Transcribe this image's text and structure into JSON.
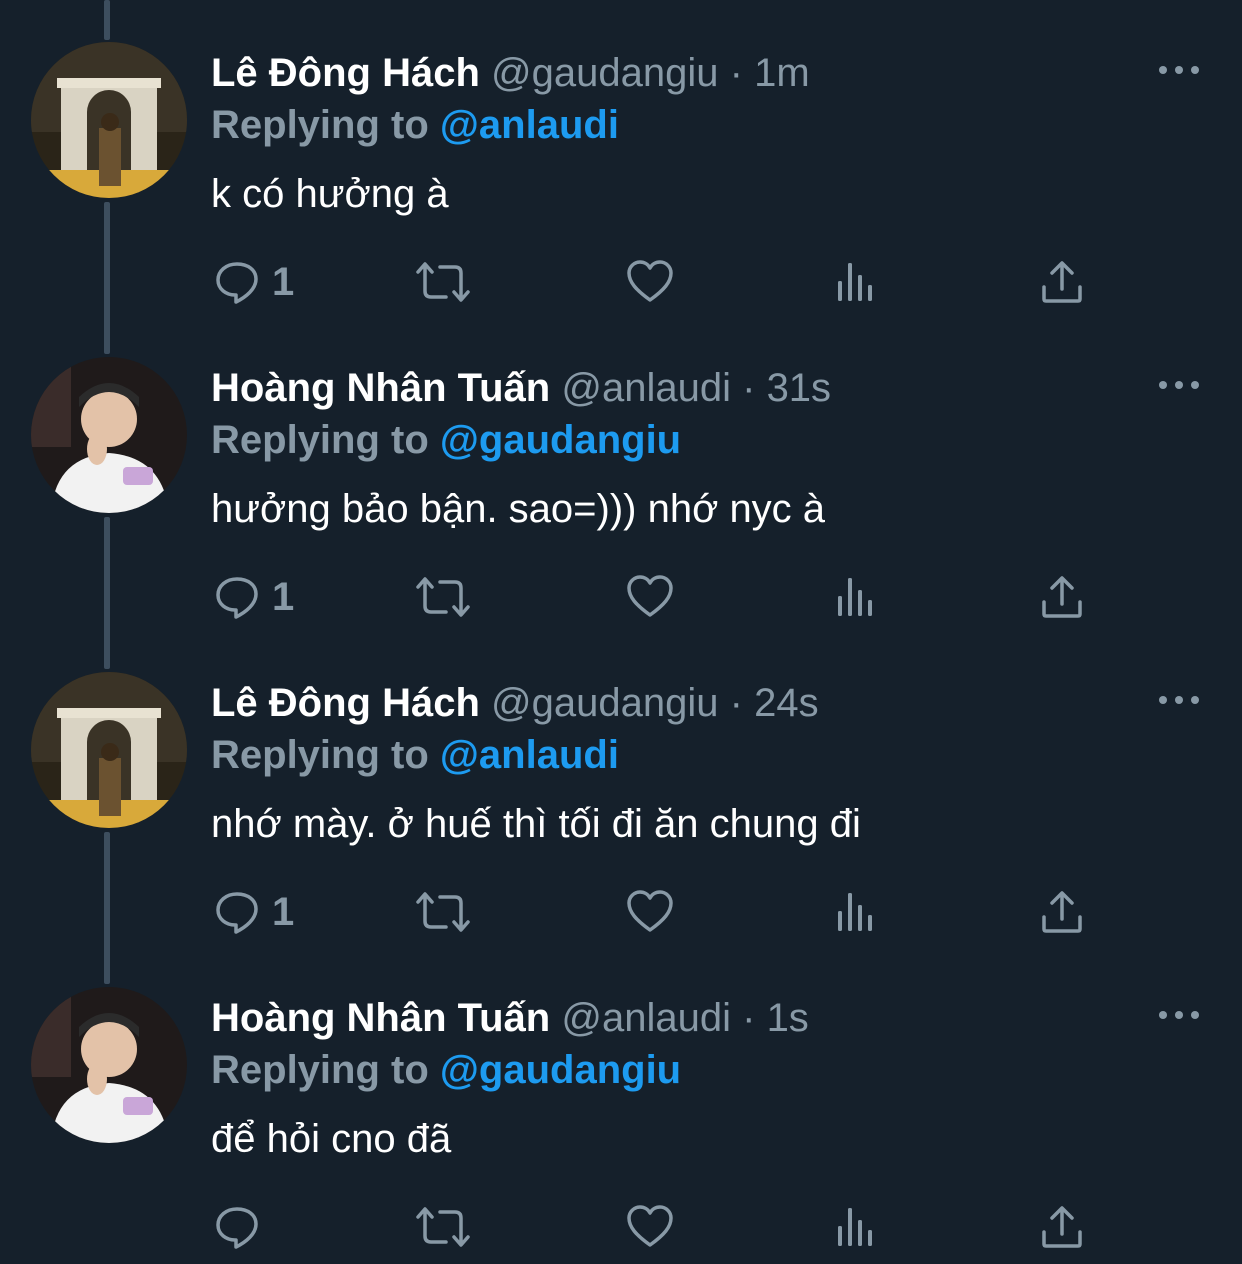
{
  "tweets": [
    {
      "display_name": "Lê Đông Hách",
      "handle": "@gaudangiu",
      "separator": "·",
      "time": "1m",
      "replying_label": "Replying to",
      "replying_handle": "@anlaudi",
      "text": "k có hưởng à",
      "reply_count": "1"
    },
    {
      "display_name": "Hoàng Nhân Tuấn",
      "handle": "@anlaudi",
      "separator": "·",
      "time": "31s",
      "replying_label": "Replying to",
      "replying_handle": "@gaudangiu",
      "text": "hưởng bảo bận. sao=))) nhớ nyc à",
      "reply_count": "1"
    },
    {
      "display_name": "Lê Đông Hách",
      "handle": "@gaudangiu",
      "separator": "·",
      "time": "24s",
      "replying_label": "Replying to",
      "replying_handle": "@anlaudi",
      "text": "nhớ mày. ở huế thì tối đi ăn chung đi",
      "reply_count": "1"
    },
    {
      "display_name": "Hoàng Nhân Tuấn",
      "handle": "@anlaudi",
      "separator": "·",
      "time": "1s",
      "replying_label": "Replying to",
      "replying_handle": "@gaudangiu",
      "text": "để hỏi cno đã",
      "reply_count": ""
    }
  ],
  "icons": {
    "reply": "reply-icon",
    "retweet": "retweet-icon",
    "like": "heart-icon",
    "views": "views-icon",
    "share": "share-icon",
    "more": "more-icon"
  },
  "colors": {
    "background": "#15202b",
    "primary_text": "#ffffff",
    "secondary_text": "#8899a6",
    "accent": "#1d9bf0",
    "thread_line": "#3d4e5e"
  }
}
